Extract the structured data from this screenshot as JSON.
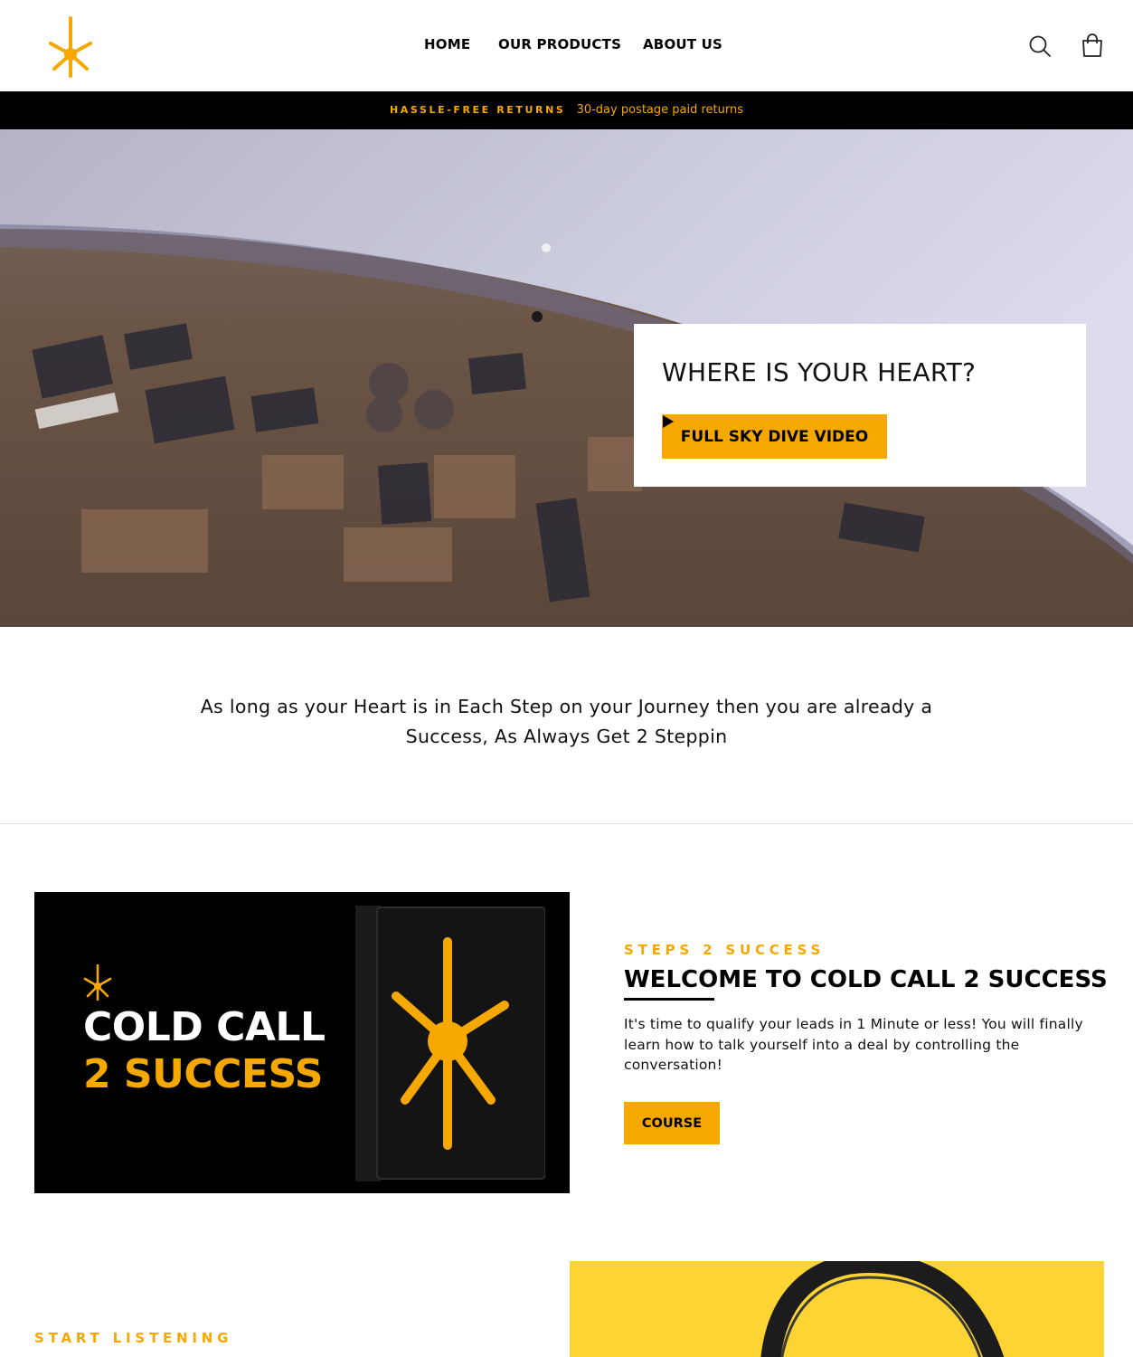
{
  "header": {
    "logo_icon": "star-burst-logo-icon",
    "nav": [
      {
        "label": "HOME"
      },
      {
        "label": "OUR PRODUCTS"
      },
      {
        "label": "ABOUT US"
      }
    ],
    "search_icon": "search-icon",
    "cart_icon": "shopping-bag-icon"
  },
  "announcement": {
    "strong": "HASSLE-FREE RETURNS",
    "text": "30-day postage paid returns"
  },
  "hero": {
    "title": "WHERE IS YOUR HEART?",
    "button_label": "FULL SKY DIVE VIDEO",
    "button_icon": "play-icon"
  },
  "quote": {
    "line1": "As long as your Heart is in Each Step on your Journey then you are already a",
    "line2": "Success, As Always Get 2 Steppin"
  },
  "feature1": {
    "image": {
      "line1": "COLD CALL",
      "line2": "2 SUCCESS"
    },
    "eyebrow": "STEPS 2 SUCCESS",
    "title": "WELCOME TO COLD CALL 2 SUCCESS",
    "body": "It's time to qualify your leads in 1 Minute or less! You will finally learn how to talk yourself into a deal by controlling the conversation!",
    "button_label": "COURSE"
  },
  "feature2": {
    "eyebrow": "START LISTENING"
  },
  "colors": {
    "accent": "#f5a800",
    "bar": "#000000",
    "headphones_bg": "#fdd432"
  }
}
